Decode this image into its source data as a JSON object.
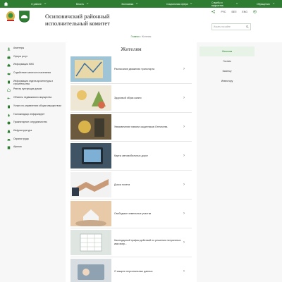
{
  "topbar": {
    "menu": [
      {
        "label": "О районе"
      },
      {
        "label": "Власть"
      },
      {
        "label": "Экономика"
      },
      {
        "label": "Социальная сфера"
      },
      {
        "label": "Службы и ведомства"
      },
      {
        "label": "Обращения"
      }
    ]
  },
  "header": {
    "title_line1": "Осиповичский районный",
    "title_line2": "исполнительный комитет",
    "lang_ru": "РУС",
    "lang_by": "БЕЛ",
    "lang_en": "ENG",
    "search_placeholder": "Искать на сайте"
  },
  "breadcrumb": {
    "home": "Главная",
    "sep": "•",
    "current": "Жителям"
  },
  "sidebar": {
    "items": [
      {
        "label": "Анкетеры"
      },
      {
        "label": "Сфера услуг"
      },
      {
        "label": "Информация ЖКХ"
      },
      {
        "label": "Содействие занятости населения"
      },
      {
        "label": "Информация отдела архитектуры и строительства"
      },
      {
        "label": "Реестр пустующих домов"
      },
      {
        "label": "Объекты недвижимого имущества"
      },
      {
        "label": "Услуги по управлению общим имуществом"
      },
      {
        "label": "Госпожнадзор информирует"
      },
      {
        "label": "Гуманитарное сотрудничество"
      },
      {
        "label": "Инфраструктура"
      },
      {
        "label": "Охрана труда"
      },
      {
        "label": "Афиша"
      }
    ]
  },
  "main": {
    "title": "Жителям",
    "rows": [
      {
        "label": "Расписание движения транспорта"
      },
      {
        "label": "Здоровый образ жизни"
      },
      {
        "label": "Увековечение памяти защитников Отечества"
      },
      {
        "label": "Карты автомобильных дорог"
      },
      {
        "label": "Доска почета"
      },
      {
        "label": "Свободные земельные участки"
      },
      {
        "label": "Календарный график действий по решению непринятых ими вопр..."
      },
      {
        "label": "О защите персональных данных"
      }
    ]
  },
  "right_nav": {
    "items": [
      {
        "label": "Жителям",
        "active": true
      },
      {
        "label": "Гостям",
        "active": false
      },
      {
        "label": "Бизнесу",
        "active": false
      },
      {
        "label": "Инвестору",
        "active": false
      }
    ]
  },
  "colors": {
    "brand": "#2e7d32",
    "active_bg": "#e8f3e8"
  }
}
